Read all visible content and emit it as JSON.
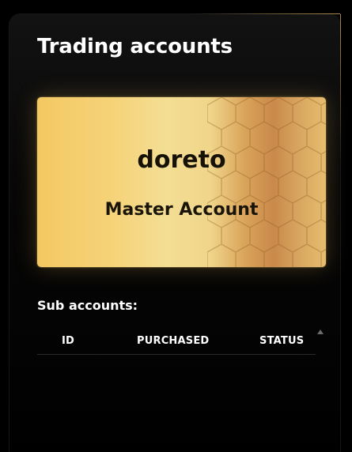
{
  "header": {
    "title": "Trading accounts"
  },
  "master_card": {
    "name": "doreto",
    "type_label": "Master Account"
  },
  "sub_accounts": {
    "title": "Sub accounts:",
    "columns": [
      "ID",
      "PURCHASED",
      "STATUS"
    ],
    "rows": []
  },
  "colors": {
    "gold_light": "#f6d277",
    "gold_dark": "#c9894a",
    "accent_border": "#c7a05a",
    "background": "#000000"
  }
}
